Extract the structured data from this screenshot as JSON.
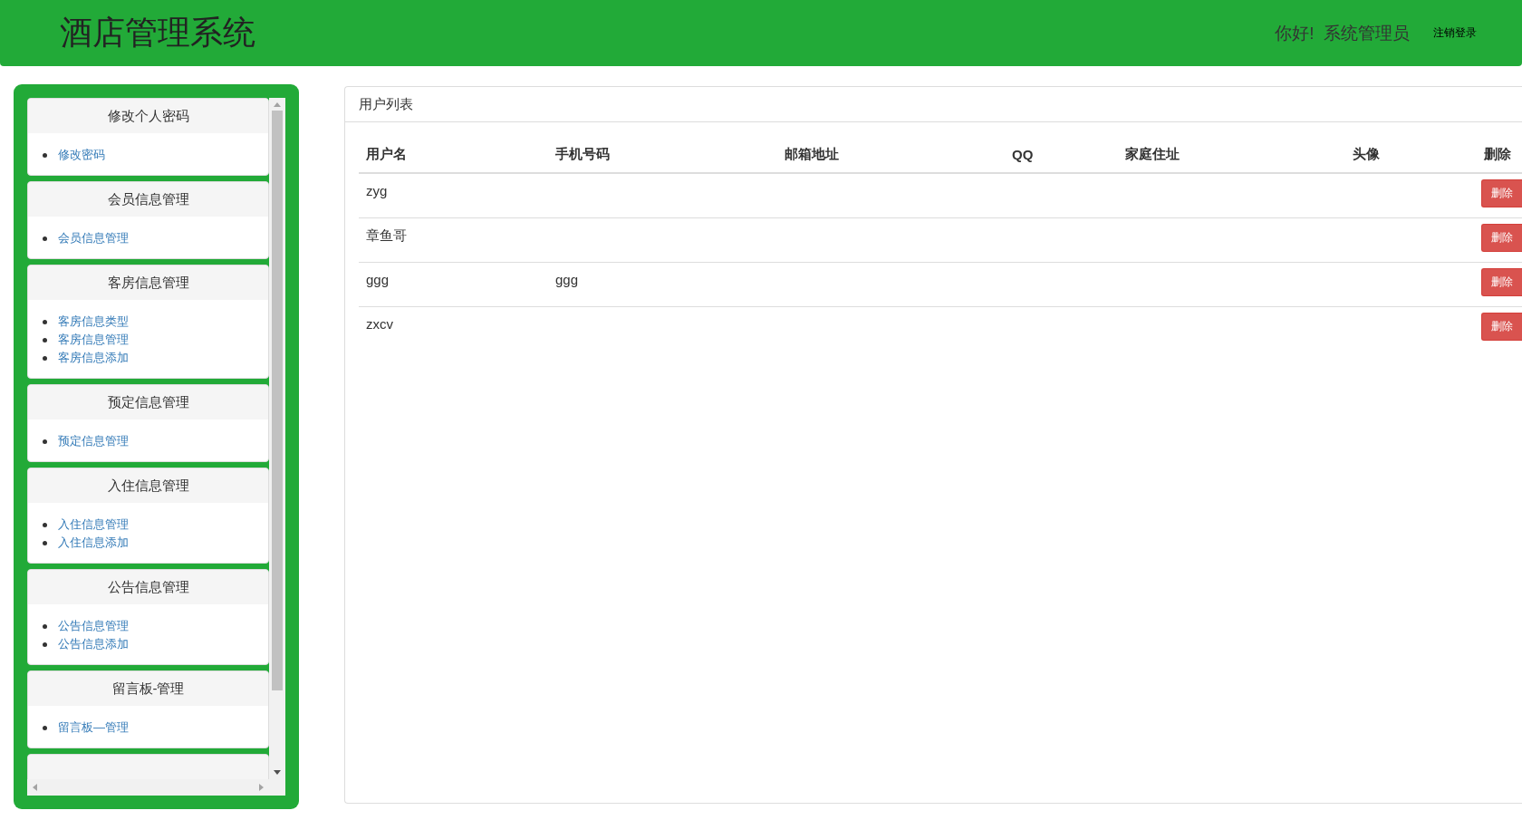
{
  "header": {
    "title": "酒店管理系统",
    "greeting": "你好!  系统管理员",
    "logout": "注销登录"
  },
  "sidebar": {
    "panels": [
      {
        "title": "修改个人密码",
        "links": [
          "修改密码"
        ]
      },
      {
        "title": "会员信息管理",
        "links": [
          "会员信息管理"
        ]
      },
      {
        "title": "客房信息管理",
        "links": [
          "客房信息类型",
          "客房信息管理",
          "客房信息添加"
        ]
      },
      {
        "title": "预定信息管理",
        "links": [
          "预定信息管理"
        ]
      },
      {
        "title": "入住信息管理",
        "links": [
          "入住信息管理",
          "入住信息添加"
        ]
      },
      {
        "title": "公告信息管理",
        "links": [
          "公告信息管理",
          "公告信息添加"
        ]
      },
      {
        "title": "留言板-管理",
        "links": [
          "留言板—管理"
        ]
      }
    ]
  },
  "user_list": {
    "title": "用户列表",
    "columns": [
      "用户名",
      "手机号码",
      "邮箱地址",
      "QQ",
      "家庭住址",
      "头像",
      "删除"
    ],
    "rows": [
      {
        "username": "zyg",
        "delete_label": "删除"
      },
      {
        "username": "章鱼哥",
        "delete_label": "删除"
      },
      {
        "username": "ggg",
        "phone": "ggg",
        "delete_label": "删除"
      },
      {
        "username": "zxcv",
        "delete_label": "删除"
      }
    ]
  }
}
